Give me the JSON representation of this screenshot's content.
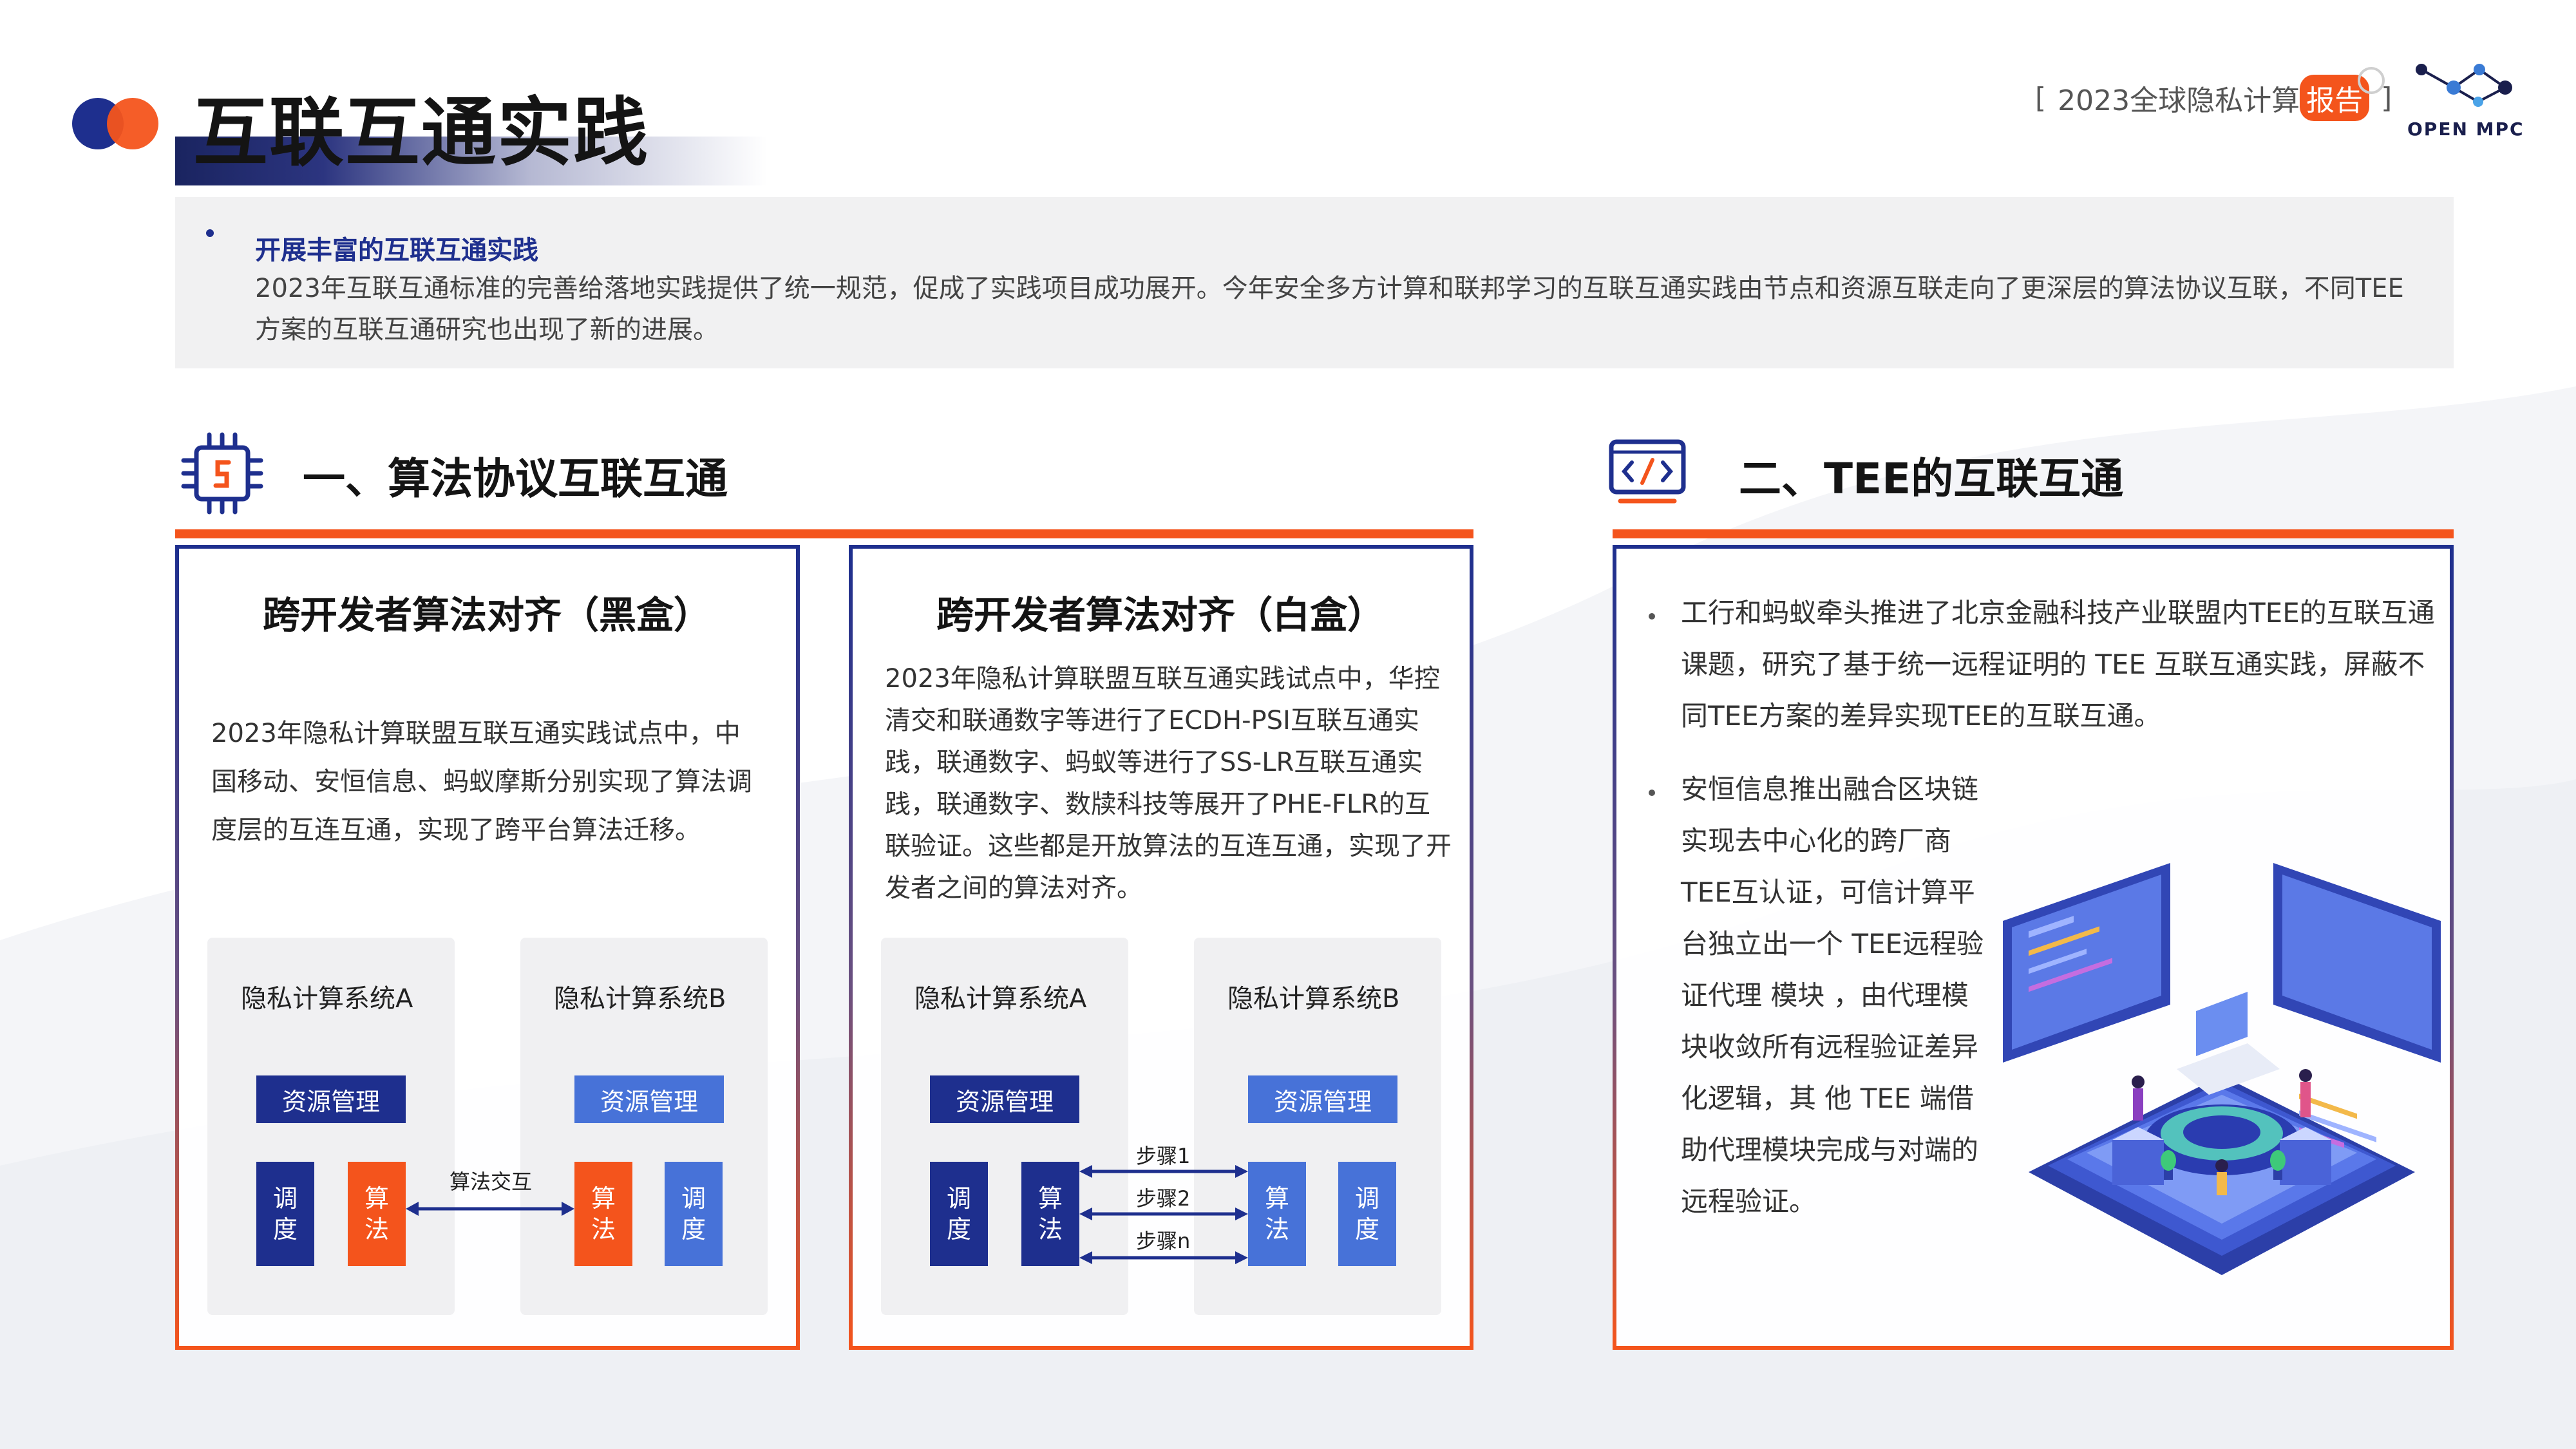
{
  "header": {
    "title": "互联互通实践",
    "report_tag_open": "[",
    "report_tag_text": "2023全球隐私计算",
    "report_tag_highlight": "报告",
    "report_tag_close": "]",
    "brand_name": "OPEN MPC"
  },
  "intro": {
    "heading": "开展丰富的互联互通实践",
    "body": "2023年互联互通标准的完善给落地实践提供了统一规范，促成了实践项目成功展开。今年安全多方计算和联邦学习的互联互通实践由节点和资源互联走向了更深层的算法协议互联，不同TEE方案的互联互通研究也出现了新的进展。"
  },
  "section1": {
    "title": "一、算法协议互联互通",
    "icon": "chip-icon",
    "left_panel": {
      "title": "跨开发者算法对齐（黑盒）",
      "text": "2023年隐私计算联盟互联互通实践试点中，中国移动、安恒信息、蚂蚁摩斯分别实现了算法调度层的互连互通，实现了跨平台算法迁移。",
      "system_a": "隐私计算系统A",
      "system_b": "隐私计算系统B",
      "resource": "资源管理",
      "schedule": "调度",
      "algorithm": "算法",
      "arrow_label": "算法交互"
    },
    "mid_panel": {
      "title": "跨开发者算法对齐（白盒）",
      "text": "2023年隐私计算联盟互联互通实践试点中，华控清交和联通数字等进行了ECDH-PSI互联互通实践，联通数字、蚂蚁等进行了SS-LR互联互通实践，联通数字、数牍科技等展开了PHE-FLR的互联验证。这些都是开放算法的互连互通，实现了开发者之间的算法对齐。",
      "system_a": "隐私计算系统A",
      "system_b": "隐私计算系统B",
      "resource": "资源管理",
      "schedule": "调度",
      "algorithm": "算法",
      "steps": [
        "步骤1",
        "步骤2",
        "步骤n"
      ]
    }
  },
  "section2": {
    "title": "二、TEE的互联互通",
    "icon": "code-icon",
    "bullets": [
      {
        "lines": [
          "工行和蚂蚁牵头推进了北京金融科技产业联盟内TEE的互联互通",
          "课题，研究了基于统一远程证明的 TEE 互联互通实践，屏蔽不",
          "同TEE方案的差异实现TEE的互联互通。"
        ]
      },
      {
        "lines": [
          "安恒信息推出融合区块链",
          "实现去中心化的跨厂商",
          "TEE互认证，可信计算平",
          "台独立出一个 TEE远程验",
          "证代理 模块 ，由代理模",
          "块收敛所有远程验证差异",
          "化逻辑，其 他 TEE 端借",
          "助代理模块完成与对端的",
          "远程验证。"
        ]
      }
    ]
  },
  "colors": {
    "navy": "#1e2f8e",
    "blue": "#4772d8",
    "orange": "#f4541c"
  }
}
